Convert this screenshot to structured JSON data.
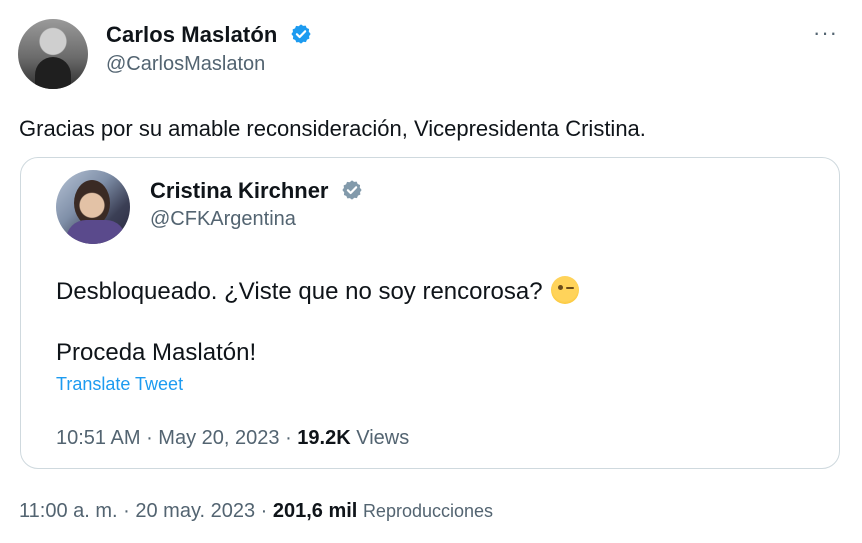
{
  "tweet": {
    "author": {
      "name": "Carlos Maslatón",
      "handle": "@CarlosMaslaton"
    },
    "more_label": "···",
    "text": "Gracias por su amable reconsideración, Vicepresidenta Cristina.",
    "meta": {
      "time": "11:00 a. m.",
      "date": "20 may. 2023",
      "views_count": "201,6 mil",
      "views_label": "Reproducciones"
    }
  },
  "quoted": {
    "author": {
      "name": "Cristina Kirchner",
      "handle": "@CFKArgentina"
    },
    "text_line1": "Desbloqueado. ¿Viste que no soy rencorosa?",
    "text_line2": "Proceda Maslatón!",
    "translate_label": "Translate Tweet",
    "meta": {
      "time": "10:51 AM",
      "date": "May 20, 2023",
      "views_count": "19.2K",
      "views_label": "Views"
    }
  },
  "colors": {
    "verified_blue": "#1d9bf0",
    "verified_gray": "#829aab",
    "link": "#1d9bf0",
    "muted": "#536471"
  },
  "icons": [
    "verified-badge-icon",
    "verified-gray-badge-icon",
    "wink-emoji-icon",
    "more-icon"
  ]
}
